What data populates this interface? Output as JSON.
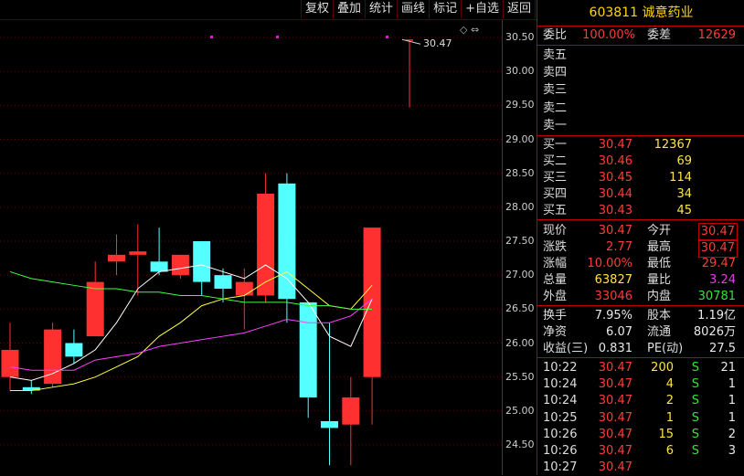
{
  "toolbar": {
    "buttons": [
      "复权",
      "叠加",
      "统计",
      "画线",
      "标记",
      "+自选",
      "返回"
    ]
  },
  "stock": {
    "code": "603811",
    "name": "诚意药业"
  },
  "header_row": {
    "wb_label": "委比",
    "wb_value": "100.00%",
    "wc_label": "委差",
    "wc_value": "12629"
  },
  "sell": [
    {
      "label": "卖五"
    },
    {
      "label": "卖四"
    },
    {
      "label": "卖三"
    },
    {
      "label": "卖二"
    },
    {
      "label": "卖一"
    }
  ],
  "buy": [
    {
      "label": "买一",
      "price": "30.47",
      "vol": "12367"
    },
    {
      "label": "买二",
      "price": "30.46",
      "vol": "69"
    },
    {
      "label": "买三",
      "price": "30.45",
      "vol": "114"
    },
    {
      "label": "买四",
      "price": "30.44",
      "vol": "34"
    },
    {
      "label": "买五",
      "price": "30.43",
      "vol": "45"
    }
  ],
  "quote": [
    {
      "l1": "现价",
      "v1": "30.47",
      "l2": "今开",
      "v2": "30.47"
    },
    {
      "l1": "涨跌",
      "v1": "2.77",
      "l2": "最高",
      "v2": "30.47"
    },
    {
      "l1": "涨幅",
      "v1": "10.00%",
      "l2": "最低",
      "v2": "29.47"
    },
    {
      "l1": "总量",
      "v1": "63827",
      "l2": "量比",
      "v2": "3.24"
    },
    {
      "l1": "外盘",
      "v1": "33046",
      "l2": "内盘",
      "v2": "30781"
    }
  ],
  "fund": [
    {
      "l1": "换手",
      "v1": "7.95%",
      "l2": "股本",
      "v2": "1.19亿"
    },
    {
      "l1": "净资",
      "v1": "6.07",
      "l2": "流通",
      "v2": "8026万"
    },
    {
      "l1": "收益(三)",
      "v1": "0.831",
      "l2": "PE(动)",
      "v2": "27.5"
    }
  ],
  "trades": [
    {
      "time": "10:22",
      "price": "30.47",
      "vol": "200",
      "side": "S",
      "n": "21"
    },
    {
      "time": "10:24",
      "price": "30.47",
      "vol": "4",
      "side": "S",
      "n": "1"
    },
    {
      "time": "10:24",
      "price": "30.47",
      "vol": "2",
      "side": "S",
      "n": "1"
    },
    {
      "time": "10:25",
      "price": "30.47",
      "vol": "1",
      "side": "S",
      "n": "1"
    },
    {
      "time": "10:26",
      "price": "30.47",
      "vol": "15",
      "side": "S",
      "n": "2"
    },
    {
      "time": "10:26",
      "price": "30.47",
      "vol": "6",
      "side": "S",
      "n": "3"
    },
    {
      "time": "10:27",
      "price": "30.47",
      "vol": "",
      "side": "",
      "n": ""
    }
  ],
  "chart_labels": {
    "last_price": "30.47"
  },
  "chart_data": {
    "type": "candlestick",
    "y_ticks": [
      "30.50",
      "30.00",
      "29.50",
      "29.00",
      "28.50",
      "28.00",
      "27.50",
      "27.00",
      "26.50",
      "26.00",
      "25.50",
      "25.00",
      "24.50"
    ],
    "ylim": [
      24.2,
      30.8
    ],
    "candles": [
      {
        "o": 25.5,
        "h": 26.3,
        "l": 25.3,
        "c": 25.9
      },
      {
        "o": 25.35,
        "h": 25.45,
        "l": 25.25,
        "c": 25.3
      },
      {
        "o": 25.4,
        "h": 26.3,
        "l": 25.35,
        "c": 26.2
      },
      {
        "o": 26.0,
        "h": 26.2,
        "l": 25.7,
        "c": 25.8
      },
      {
        "o": 26.1,
        "h": 27.2,
        "l": 26.1,
        "c": 26.9
      },
      {
        "o": 27.2,
        "h": 27.6,
        "l": 27.0,
        "c": 27.3
      },
      {
        "o": 27.3,
        "h": 27.75,
        "l": 26.7,
        "c": 27.35
      },
      {
        "o": 27.2,
        "h": 27.7,
        "l": 27.0,
        "c": 27.05
      },
      {
        "o": 27.0,
        "h": 27.3,
        "l": 26.95,
        "c": 27.3
      },
      {
        "o": 27.5,
        "h": 27.5,
        "l": 26.7,
        "c": 26.9
      },
      {
        "o": 27.0,
        "h": 27.1,
        "l": 26.6,
        "c": 26.8
      },
      {
        "o": 26.7,
        "h": 27.1,
        "l": 26.2,
        "c": 26.9
      },
      {
        "o": 26.7,
        "h": 28.5,
        "l": 26.6,
        "c": 28.2
      },
      {
        "o": 28.35,
        "h": 28.5,
        "l": 26.3,
        "c": 26.65
      },
      {
        "o": 26.6,
        "h": 26.6,
        "l": 24.9,
        "c": 25.2
      },
      {
        "o": 24.85,
        "h": 26.3,
        "l": 24.2,
        "c": 24.75
      },
      {
        "o": 24.8,
        "h": 25.5,
        "l": 24.2,
        "c": 25.2
      },
      {
        "o": 25.5,
        "h": 27.7,
        "l": 24.8,
        "c": 27.7
      },
      {
        "o": 30.47,
        "h": 30.47,
        "l": 29.47,
        "c": 30.47
      }
    ],
    "ma_series": [
      {
        "color": "#ffffff",
        "values": [
          25.5,
          25.45,
          25.55,
          25.7,
          25.9,
          26.3,
          26.8,
          27.05,
          27.1,
          27.15,
          27.05,
          26.95,
          27.15,
          26.95,
          26.6,
          26.1,
          25.95,
          26.65,
          null
        ]
      },
      {
        "color": "#ffff40",
        "values": [
          25.3,
          25.3,
          25.35,
          25.4,
          25.5,
          25.65,
          25.8,
          26.1,
          26.3,
          26.55,
          26.65,
          26.7,
          26.9,
          27.05,
          26.8,
          26.55,
          26.5,
          26.85,
          null
        ]
      },
      {
        "color": "#ff40ff",
        "values": [
          25.65,
          25.6,
          25.6,
          25.6,
          25.75,
          25.8,
          25.85,
          25.95,
          26.0,
          26.05,
          26.1,
          26.15,
          26.25,
          26.35,
          26.3,
          26.3,
          26.4,
          26.65,
          null
        ]
      },
      {
        "color": "#40ff40",
        "values": [
          27.05,
          26.95,
          26.9,
          26.85,
          26.8,
          26.8,
          26.75,
          26.75,
          26.7,
          26.7,
          26.65,
          26.6,
          26.6,
          26.6,
          26.55,
          26.55,
          26.5,
          26.5,
          null
        ]
      }
    ]
  }
}
